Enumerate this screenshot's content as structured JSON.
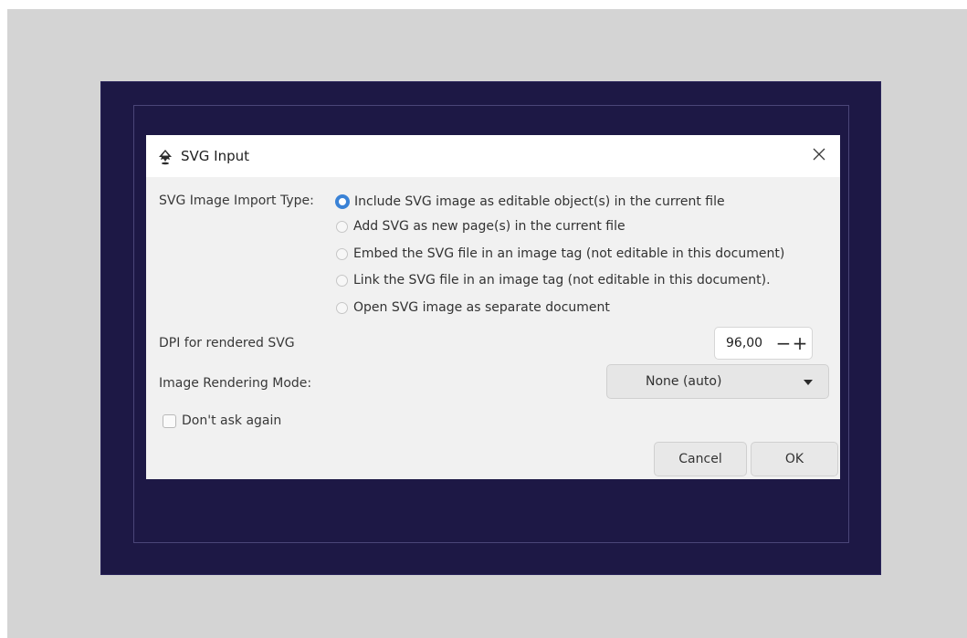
{
  "dialog": {
    "title": "SVG Input",
    "app_icon": "inkscape-icon",
    "close_icon": "close-icon"
  },
  "import_type": {
    "label": "SVG Image Import Type:",
    "selected_index": 0,
    "options": [
      "Include SVG image as editable object(s) in the current file",
      "Add SVG as new page(s) in the current file",
      "Embed the SVG file in an image tag (not editable in this document)",
      "Link the SVG file in an image tag (not editable in this document).",
      "Open SVG image as separate document"
    ]
  },
  "dpi": {
    "label": "DPI for rendered SVG",
    "value": "96,00",
    "decrement": "−",
    "increment": "+"
  },
  "rendering_mode": {
    "label": "Image Rendering Mode:",
    "value": "None (auto)"
  },
  "dont_ask": {
    "label": "Don't ask again",
    "checked": false
  },
  "buttons": {
    "cancel": "Cancel",
    "ok": "OK"
  },
  "colors": {
    "accent": "#3a82d6",
    "backdrop": "#1d1845",
    "outer_background": "#d4d4d4"
  }
}
